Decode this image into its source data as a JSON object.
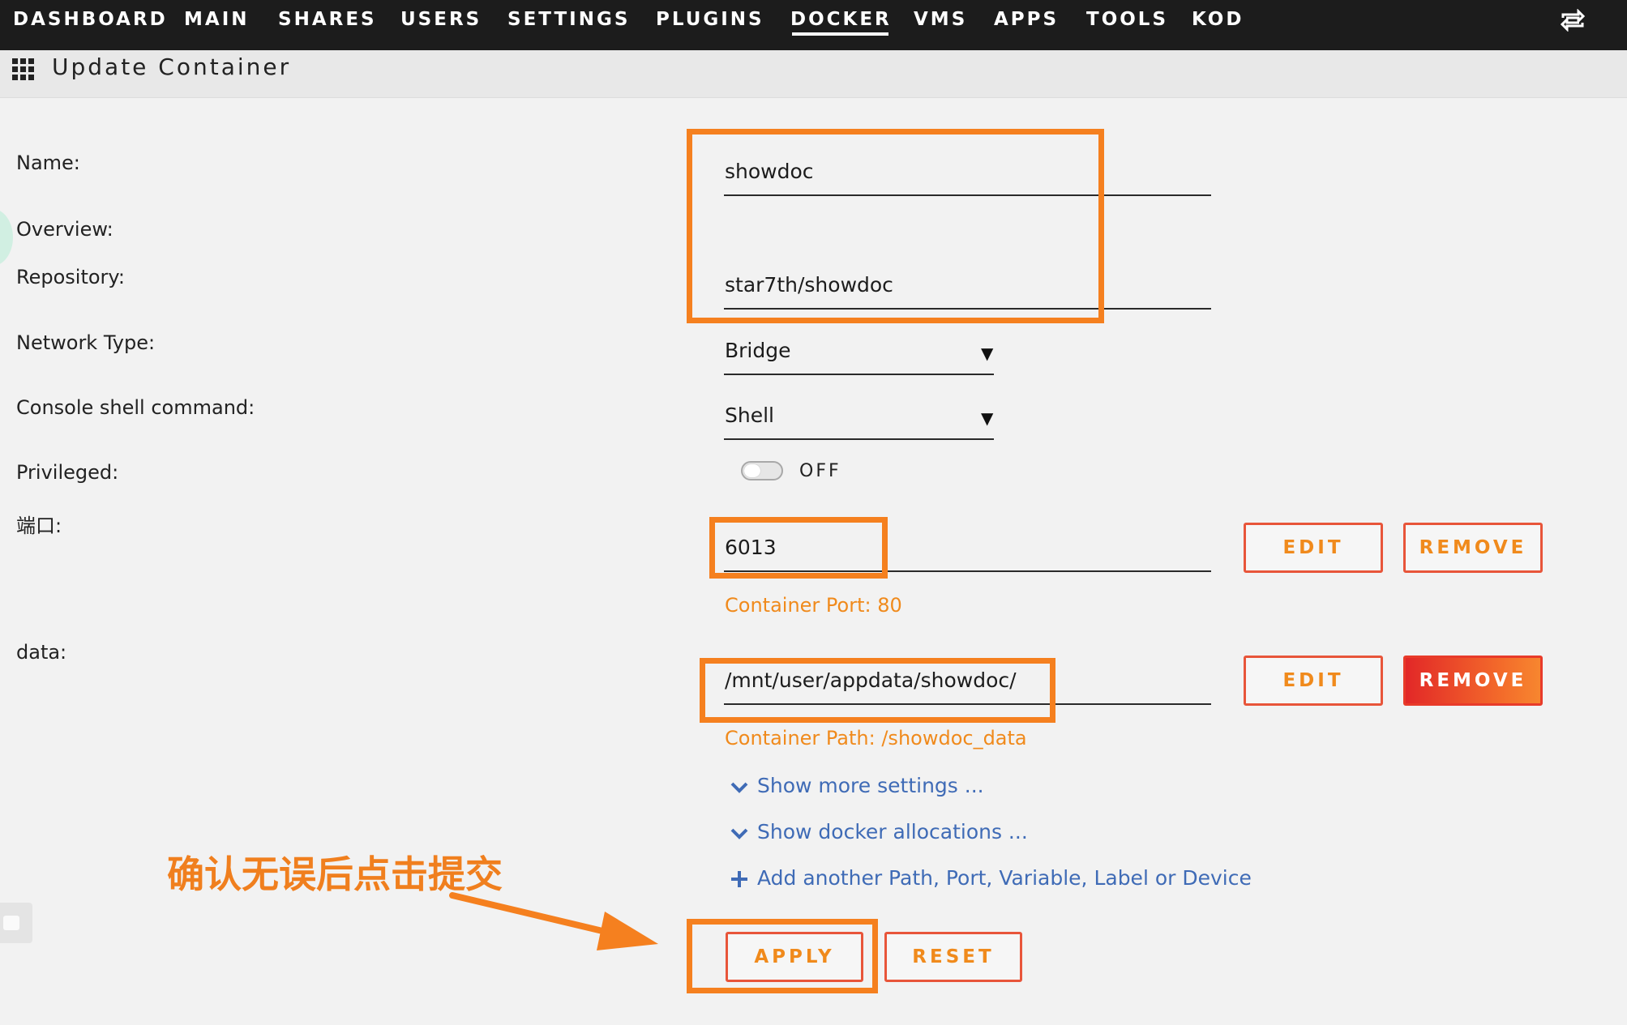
{
  "nav": {
    "items": [
      "DASHBOARD",
      "MAIN",
      "SHARES",
      "USERS",
      "SETTINGS",
      "PLUGINS",
      "DOCKER",
      "VMS",
      "APPS",
      "TOOLS",
      "KOD"
    ],
    "active": "DOCKER",
    "switch_icon": "switch-arrows-icon"
  },
  "header": {
    "title": "Update Container",
    "icon": "grid-icon"
  },
  "form": {
    "name": {
      "label": "Name:",
      "value": "showdoc"
    },
    "overview": {
      "label": "Overview:"
    },
    "repository": {
      "label": "Repository:",
      "value": "star7th/showdoc"
    },
    "network_type": {
      "label": "Network Type:",
      "value": "Bridge"
    },
    "console_shell": {
      "label": "Console shell command:",
      "value": "Shell"
    },
    "privileged": {
      "label": "Privileged:",
      "state": "OFF"
    },
    "port": {
      "label": "端口:",
      "value": "6013",
      "hint": "Container Port: 80",
      "edit_label": "EDIT",
      "remove_label": "REMOVE"
    },
    "data": {
      "label": "data:",
      "value": "/mnt/user/appdata/showdoc/",
      "hint": "Container Path: /showdoc_data",
      "edit_label": "EDIT",
      "remove_label": "REMOVE"
    }
  },
  "links": {
    "more_settings": "Show more settings ...",
    "docker_allocations": "Show docker allocations ...",
    "add_another": "Add another Path, Port, Variable, Label or Device"
  },
  "actions": {
    "apply_label": "APPLY",
    "reset_label": "RESET"
  },
  "annotation": {
    "note": "确认无误后点击提交",
    "color": "#f5801f"
  },
  "colors": {
    "nav_bg": "#1c1c1c",
    "accent_orange": "#f08a1c",
    "button_border": "#e8553a",
    "link_blue": "#3f6bb6"
  }
}
